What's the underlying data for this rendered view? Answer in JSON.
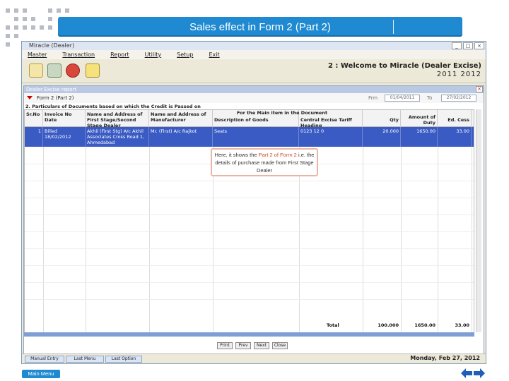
{
  "slide": {
    "title": "Sales effect in Form 2 (Part 2)",
    "main_menu": "Main Menu"
  },
  "app": {
    "window_title": "Miracle (Dealer)",
    "menu": [
      "Master",
      "Transaction",
      "Report",
      "Utility",
      "Setup",
      "Exit"
    ],
    "toolbar_icons": [
      "documents-icon",
      "cart-icon",
      "money-bag-icon",
      "notepad-icon"
    ],
    "welcome": "2 : Welcome to Miracle (Dealer Excise)",
    "year": "2011  2012"
  },
  "child": {
    "title": "Dealer Excise report",
    "form_name": "Form 2 (Part 2)",
    "from_label": "Frm",
    "from_date": "01/04/2011",
    "to_label": "To",
    "to_date": "27/02/2012",
    "particulars": "2. Particulars of Documents based on which the Credit is Passed on"
  },
  "grid": {
    "group_header": "For the Main item in the Document",
    "headers": [
      "Sr.No",
      "Invoice No Date",
      "Name and Address of First Stage/Second Stage Dealer",
      "Name and Address of Manufacturer",
      "Description of Goods",
      "Central Excise Tariff Heading",
      "Qty",
      "Amount of Duty",
      "Ed. Cess"
    ],
    "row": {
      "sr": "1",
      "invoice": "Billed 18/02/2012",
      "dealer": "Akhil (First Stg) A/c Akhil Associates Cross Road 1, Ahmedabad",
      "manufacturer": "Mr. (First) A/c Rajkot",
      "goods": "Seats",
      "tariff": "0123 12 0",
      "qty": "20.000",
      "duty": "1650.00",
      "cess": "33.00"
    },
    "total_label": "Total",
    "total_qty": "100.000",
    "total_duty": "1650.00",
    "total_cess": "33.00"
  },
  "buttons": [
    "Print",
    "Prev",
    "Next",
    "Close"
  ],
  "taskbar": [
    "Manual Entry",
    "Last Menu",
    "Last Option"
  ],
  "datetime": "Monday, Feb 27, 2012",
  "callout": {
    "before": "Here, it shows the",
    "highlight": "Part 2 of Form 2",
    "after": "i.e. the details of purchase made from First Stage Dealer"
  }
}
